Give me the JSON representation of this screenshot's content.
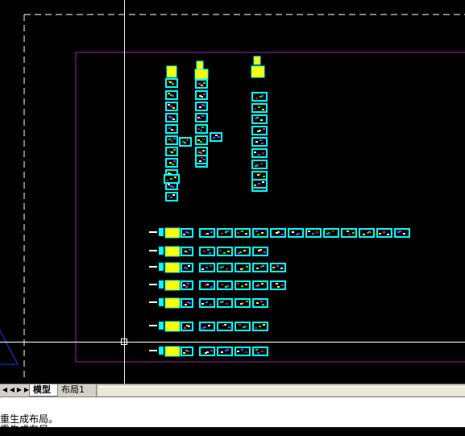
{
  "tabs": {
    "model_label": "模型",
    "layout1_label": "布局1"
  },
  "command_history": [
    "重生成布局。",
    "重生成布局。"
  ],
  "colors": {
    "background": "#000000",
    "viewport_border": "#a020a0",
    "drawing_thumb": "#00ffff",
    "drawing_fill": "#ffff00",
    "paper_boundary": "#ffffff"
  }
}
